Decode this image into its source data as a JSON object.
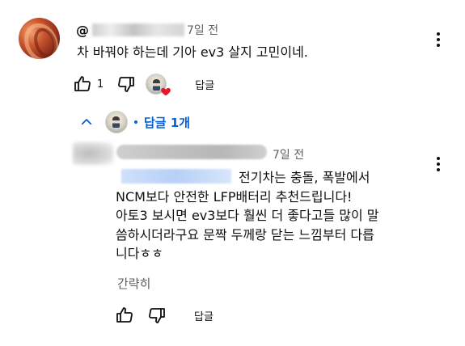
{
  "comment": {
    "handle_prefix": "@",
    "time": "7일 전",
    "text": "차 바꿔야 하는데 기아 ev3 살지 고민이네.",
    "like_count": "1",
    "reply_label": "답글",
    "replies_toggle": "답글 1개",
    "icons": [
      "user-avatar",
      "more-vert-icon",
      "thumb-up-icon",
      "thumb-down-icon",
      "creator-avatar",
      "heart-icon",
      "chevron-up-icon"
    ]
  },
  "reply": {
    "time": "7일 전",
    "lines": [
      "전기차는 충돌, 폭발에서",
      "NCM보다 안전한 LFP배터리 추천드립니다!",
      "아토3 보시면 ev3보다 훨씬 더 좋다고들 많이 말",
      "씀하시더라구요 문짝 두께랑 닫는 느낌부터 다릅",
      "니다ㅎㅎ"
    ],
    "read_less": "간략히",
    "reply_label": "답글"
  },
  "colors": {
    "link_blue": "#065fd4",
    "heart_red": "#e8142a",
    "secondary_text": "#606060"
  }
}
